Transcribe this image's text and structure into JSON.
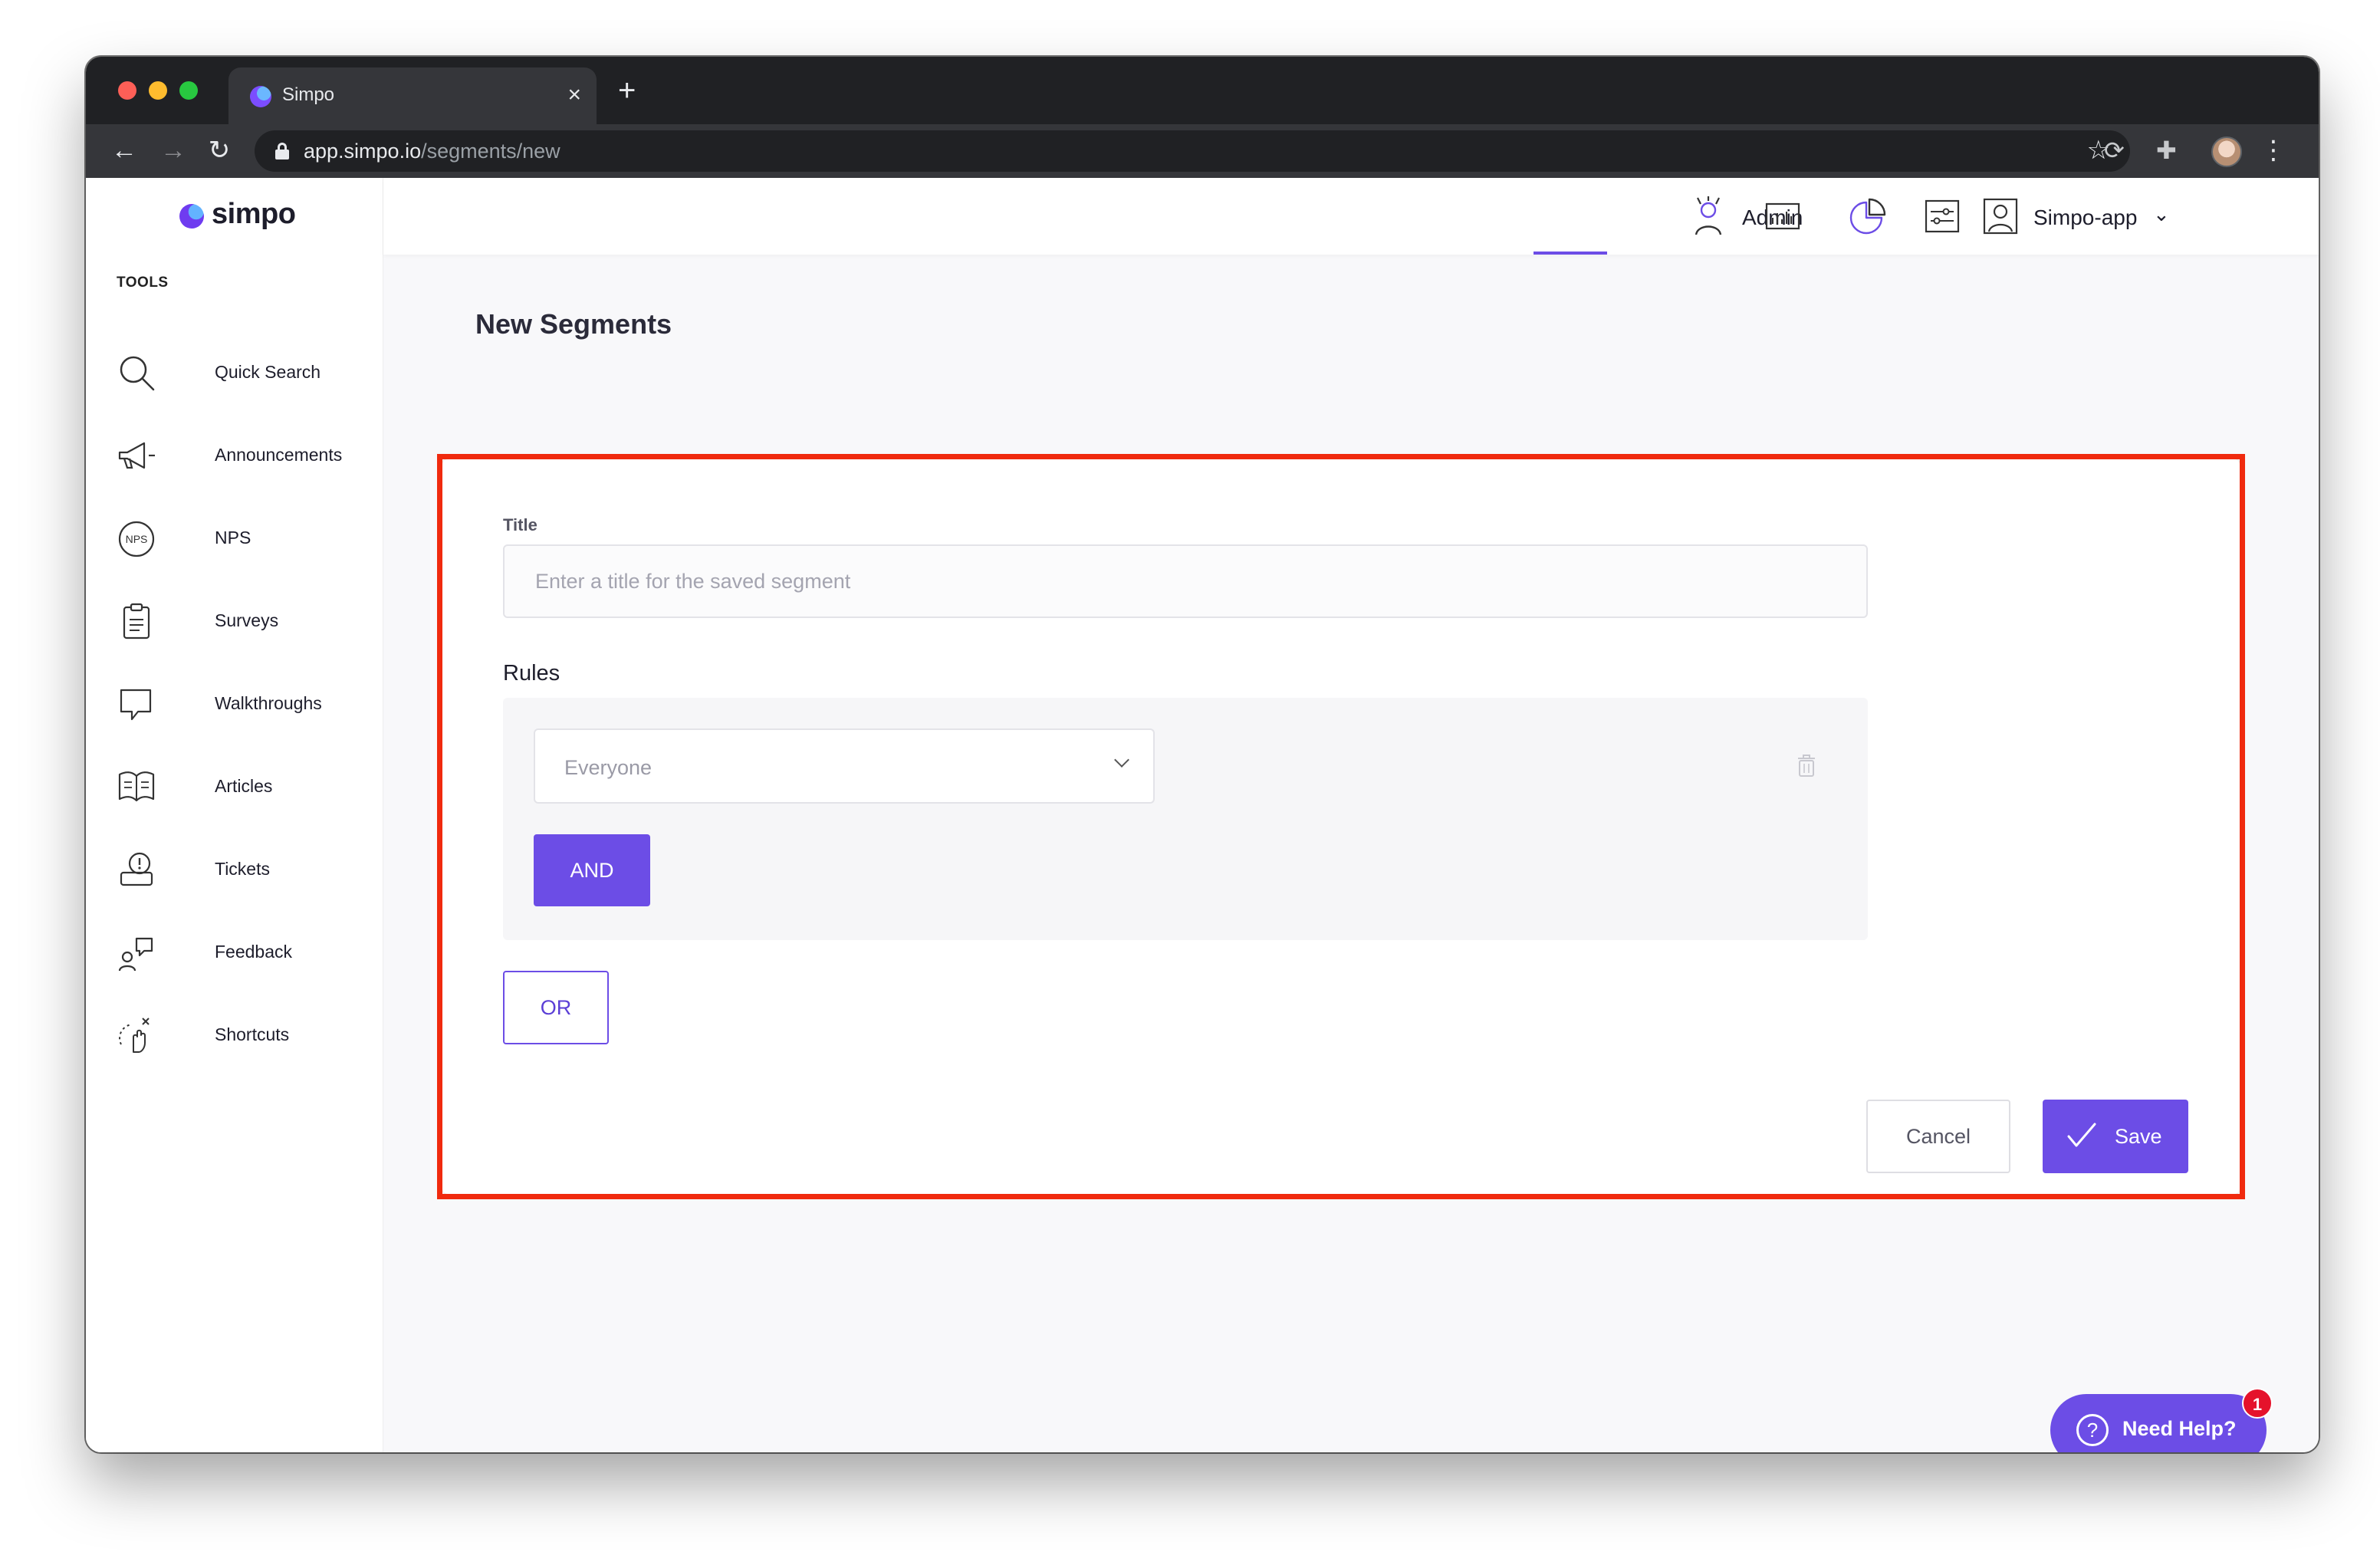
{
  "browser": {
    "tab_title": "Simpo",
    "tab_close": "×",
    "new_tab": "+",
    "url_host": "app.simpo.io",
    "url_path": "/segments/new"
  },
  "sidebar": {
    "logo_text": "simpo",
    "section_label": "TOOLS",
    "items": [
      {
        "label": "Quick Search",
        "icon": "search-icon"
      },
      {
        "label": "Announcements",
        "icon": "megaphone-icon"
      },
      {
        "label": "NPS",
        "icon": "nps-icon"
      },
      {
        "label": "Surveys",
        "icon": "clipboard-icon"
      },
      {
        "label": "Walkthroughs",
        "icon": "speech-bubble-icon"
      },
      {
        "label": "Articles",
        "icon": "book-icon"
      },
      {
        "label": "Tickets",
        "icon": "ticket-icon"
      },
      {
        "label": "Feedback",
        "icon": "feedback-icon"
      },
      {
        "label": "Shortcuts",
        "icon": "hand-pointer-icon"
      }
    ]
  },
  "header": {
    "admin_label": "Admin",
    "account_label": "Simpo-app",
    "account_chevron": "⌄",
    "active_icon": "pie-chart-icon"
  },
  "page": {
    "title": "New Segments"
  },
  "form": {
    "title_label": "Title",
    "title_value": "",
    "title_placeholder": "Enter a title for the saved segment",
    "rules_label": "Rules",
    "rule_select_value": "Everyone",
    "and_button": "AND",
    "or_button": "OR",
    "cancel_button": "Cancel",
    "save_button": "Save"
  },
  "help": {
    "label": "Need Help?",
    "badge_count": "1",
    "question_mark": "?"
  },
  "colors": {
    "accent": "#6c4de6",
    "highlight_border": "#f02a0e",
    "badge": "#e5122b"
  }
}
